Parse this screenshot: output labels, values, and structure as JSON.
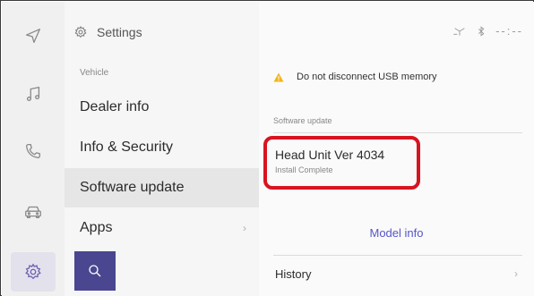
{
  "rail": {
    "items": [
      {
        "icon": "navigation-icon"
      },
      {
        "icon": "music-icon"
      },
      {
        "icon": "phone-icon"
      },
      {
        "icon": "car-icon"
      },
      {
        "icon": "settings-gear-icon"
      }
    ]
  },
  "settings": {
    "title": "Settings",
    "section_label": "Vehicle",
    "items": [
      {
        "label": "Dealer info"
      },
      {
        "label": "Info & Security"
      },
      {
        "label": "Software update"
      },
      {
        "label": "Apps",
        "chevron": "›"
      }
    ]
  },
  "status_bar": {
    "time": "--:--"
  },
  "main": {
    "warning_text": "Do not disconnect USB memory",
    "section_label": "Software update",
    "version_title": "Head Unit Ver 4034",
    "version_status": "Install Complete",
    "model_info_label": "Model info",
    "history_label": "History",
    "history_chevron": "›"
  },
  "colors": {
    "accent": "#4b4690",
    "link": "#5656c8",
    "highlight_box": "#d8141f",
    "warning": "#f2b51a"
  }
}
